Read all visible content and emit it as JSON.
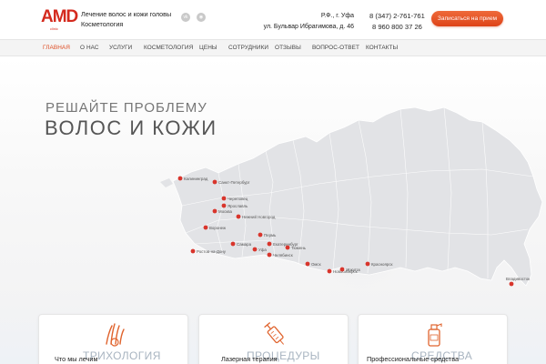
{
  "header": {
    "logo_text": "AMD",
    "logo_sub": "clinic",
    "tagline_line1": "Лечение волос и кожи головы",
    "tagline_line2": "Косметология",
    "social": [
      {
        "name": "vk",
        "glyph": "vk"
      },
      {
        "name": "instagram",
        "glyph": "◉"
      }
    ],
    "address_line1": "Р.Ф., г. Уфа",
    "address_line2": "ул. Бульвар Ибрагимова, д. 46",
    "phone1": "8 (347) 2-761-761",
    "phone2": "8 960 800 37 26",
    "cta_label": "Записаться на прием",
    "accent_color": "#de4b22"
  },
  "nav": {
    "items": [
      {
        "label": "ГЛАВНАЯ",
        "active": true
      },
      {
        "label": "О НАС",
        "active": false
      },
      {
        "label": "УСЛУГИ",
        "active": false
      },
      {
        "label": "КОСМЕТОЛОГИЯ",
        "active": false
      },
      {
        "label": "ЦЕНЫ",
        "active": false
      },
      {
        "label": "СОТРУДНИКИ",
        "active": false
      },
      {
        "label": "ОТЗЫВЫ",
        "active": false
      },
      {
        "label": "ВОПРОС-ОТВЕТ",
        "active": false
      },
      {
        "label": "КОНТАКТЫ",
        "active": false
      }
    ]
  },
  "hero": {
    "title_line1": "РЕШАЙТЕ ПРОБЛЕМУ",
    "title_line2": "ВОЛОС И КОЖИ"
  },
  "map": {
    "cities": [
      {
        "name": "Калининград"
      },
      {
        "name": "Санкт-Петербург"
      },
      {
        "name": "Череповец"
      },
      {
        "name": "Москва"
      },
      {
        "name": "Ярославль"
      },
      {
        "name": "Нижний Новгород"
      },
      {
        "name": "Воронеж"
      },
      {
        "name": "Пермь"
      },
      {
        "name": "Самара"
      },
      {
        "name": "Уфа"
      },
      {
        "name": "Екатеринбург"
      },
      {
        "name": "Тюмень"
      },
      {
        "name": "Челябинск"
      },
      {
        "name": "Ростов-на-Дону"
      },
      {
        "name": "Омск"
      },
      {
        "name": "Новосибирск"
      },
      {
        "name": "Красноярск"
      },
      {
        "name": "Иркутск"
      },
      {
        "name": "Владивосток"
      }
    ],
    "marker_color": "#d8352c"
  },
  "cards": [
    {
      "label_small": "Что мы лечим",
      "label_big": "ТРИХОЛОГИЯ",
      "icon": "hair-follicle-icon"
    },
    {
      "label_small": "Лазерная терапия",
      "label_big": "ПРОЦЕДУРЫ",
      "icon": "syringe-icon"
    },
    {
      "label_small": "Профессиональные средства",
      "label_big": "СРЕДСТВА",
      "icon": "bottle-icon"
    }
  ]
}
